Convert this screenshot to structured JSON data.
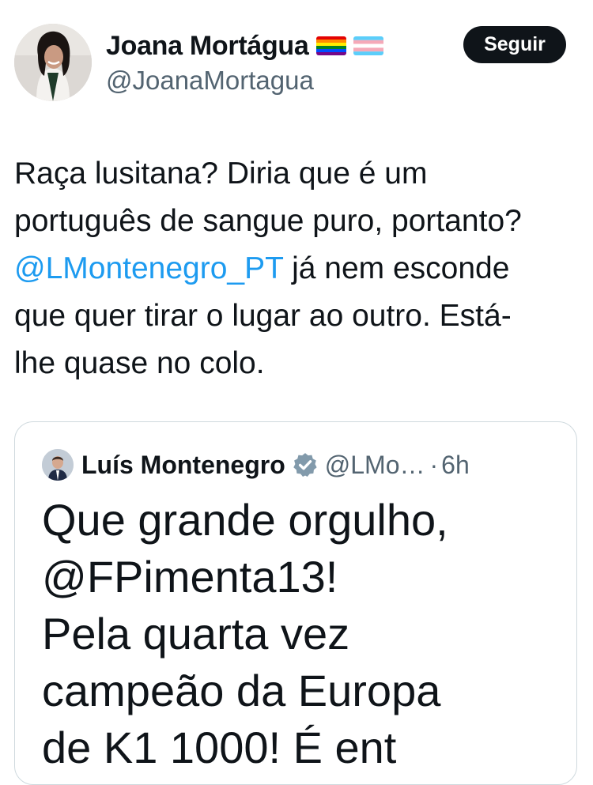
{
  "author": {
    "display_name": "Joana Mortágua",
    "handle": "@JoanaMortagua",
    "flags": [
      "rainbow-pride-flag-icon",
      "transgender-flag-icon"
    ]
  },
  "follow_button": {
    "label": "Seguir"
  },
  "tweet": {
    "lines": [
      [
        {
          "text": "Raça lusitana? Diria que é um",
          "type": "text"
        }
      ],
      [
        {
          "text": "português de sangue puro, portanto?",
          "type": "text"
        }
      ],
      [
        {
          "text": "@LMontenegro_PT",
          "type": "mention"
        },
        {
          "text": " já nem esconde",
          "type": "text"
        }
      ],
      [
        {
          "text": "que quer tirar o lugar ao outro. Está-",
          "type": "text"
        }
      ],
      [
        {
          "text": "lhe quase no colo.",
          "type": "text"
        }
      ]
    ]
  },
  "quoted_tweet": {
    "display_name": "Luís Montenegro",
    "verified_icon": "verified-badge-icon",
    "handle": "@LMo…",
    "separator": "·",
    "time": "6h",
    "lines": [
      "Que grande orgulho,",
      "@FPimenta13!",
      "Pela quarta vez",
      "campeão da Europa",
      "de K1 1000! É ent"
    ]
  },
  "colors": {
    "text": "#0f1419",
    "secondary": "#536471",
    "link": "#1d9bf0",
    "button_bg": "#0f1419",
    "border": "#cfd9de"
  }
}
